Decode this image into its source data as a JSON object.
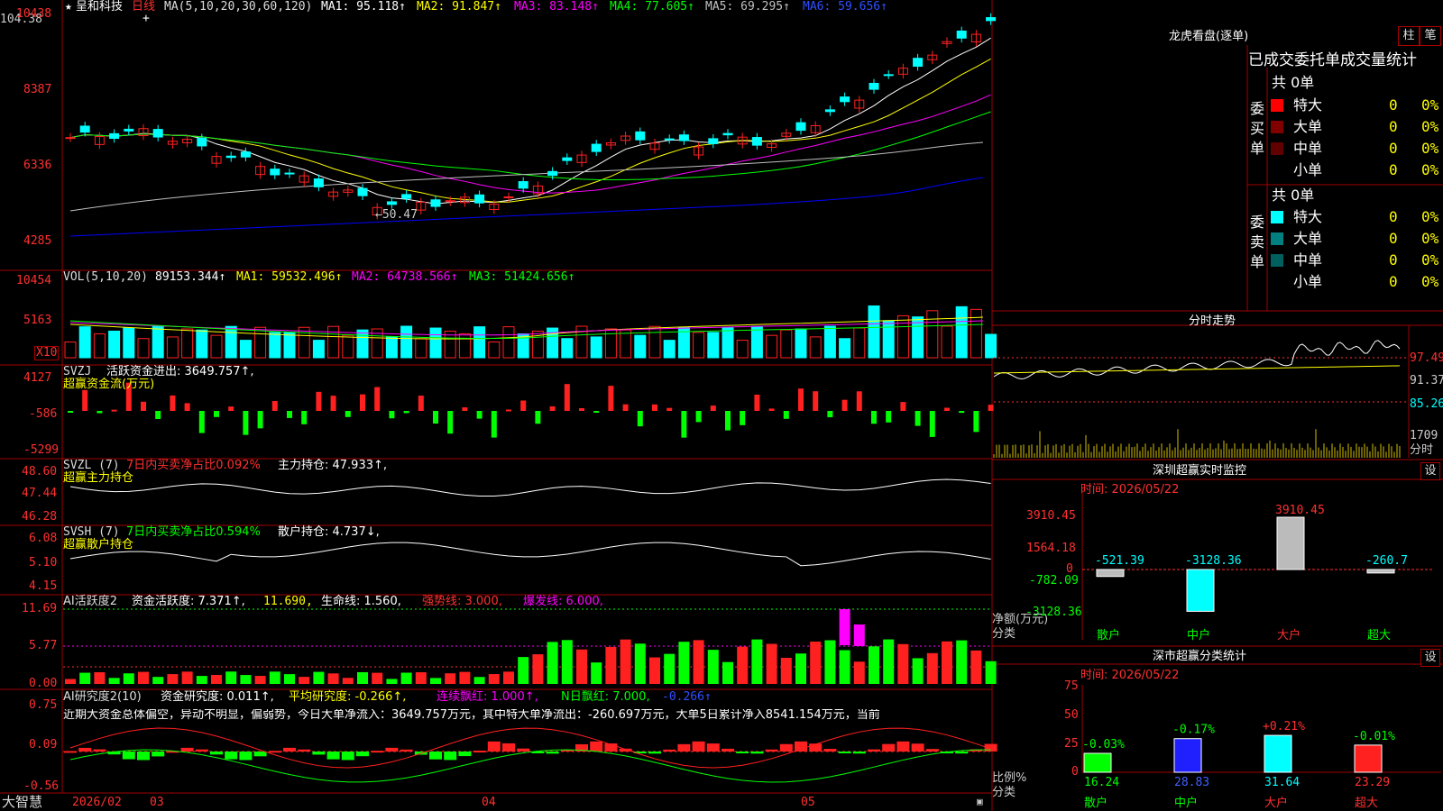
{
  "app": {
    "brand": "大智慧"
  },
  "stock": {
    "name": "呈和科技",
    "period": "日线"
  },
  "colors": {
    "up": "#ff2020",
    "down": "#00ffff",
    "bg": "#000000",
    "frame": "#a00000",
    "ma1": "#ffffff",
    "ma2": "#ffff00",
    "ma3": "#ff00ff",
    "ma4": "#00ff00",
    "ma5": "#c0c0c0",
    "ma6": "#0000ff",
    "axis_text": "#ff3030",
    "green": "#00ff00",
    "magenta": "#ff00ff",
    "yellow": "#ffff00"
  },
  "main_panel": {
    "header": {
      "ma_label": "MA(5,10,20,30,60,120)",
      "ma1": "MA1: 95.118↑",
      "ma2": "MA2: 91.847↑",
      "ma3": "MA3: 83.148↑",
      "ma4": "MA4: 77.605↑",
      "ma5": "MA5: 69.295↑",
      "ma6": "MA6: 59.656↑"
    },
    "y_ticks": [
      "10438",
      "8387",
      "6336",
      "4285"
    ],
    "high_label": "104.38",
    "low_label": "←50.47"
  },
  "vol_panel": {
    "header": {
      "label": "VOL(5,10,20)",
      "value": "89153.344↑",
      "ma1": "MA1: 59532.496↑",
      "ma2": "MA2: 64738.566↑",
      "ma3": "MA3: 51424.656↑"
    },
    "y_ticks": [
      "10454",
      "5163"
    ],
    "unit": "X10"
  },
  "svzj_panel": {
    "header": {
      "label": "SVZJ",
      "title": "活跃资金进出: 3649.757↑,",
      "subtitle": "超赢资金流(万元)"
    },
    "y_ticks": [
      "4127",
      "-586",
      "-5299"
    ]
  },
  "svzl_panel": {
    "header": {
      "label": "SVZL (7)",
      "ratio": "7日内买卖净占比0.092%",
      "hold": "主力持仓: 47.933↑,",
      "subtitle": "超赢主力持仓"
    },
    "y_ticks": [
      "48.60",
      "47.44",
      "46.28"
    ]
  },
  "svsh_panel": {
    "header": {
      "label": "SVSH (7)",
      "ratio": "7日内买卖净占比0.594%",
      "hold": "散户持仓: 4.737↓,",
      "subtitle": "超赢散户持仓"
    },
    "y_ticks": [
      "6.08",
      "5.10",
      "4.15"
    ]
  },
  "ai_active_panel": {
    "header": {
      "label": "AI活跃度2",
      "active": "资金活跃度: 7.371↑,",
      "v2": "11.690,",
      "life": "生命线: 1.560,",
      "strong": "强势线: 3.000,",
      "burst": "爆发线: 6.000,"
    },
    "y_ticks": [
      "11.69",
      "5.77",
      "0.00"
    ]
  },
  "ai_research_panel": {
    "header": {
      "label": "AI研究度2(10)",
      "research": "资金研究度: 0.011↑,",
      "avg": "平均研究度: -0.266↑,",
      "streak": "连续飘红: 1.000↑,",
      "nday": "N日飘红: 7.000,",
      "last": "-0.266↑"
    },
    "comment": "近期大资金总体偏空，异动不明显，偏弱势，今日大单净流入：3649.757万元，其中特大单净流出：-260.697万元，大单5日累计净入8541.154万元，当前",
    "y_ticks": [
      "0.75",
      "0.09",
      "-0.56"
    ]
  },
  "x_axis": {
    "labels": [
      "2026/02",
      "03",
      "04",
      "05"
    ]
  },
  "dragon_tiger": {
    "title": "龙虎看盘(逐单)",
    "btn_bar": "柱",
    "btn_stroke": "笔",
    "subtitle": "已成交委托单成交量统计",
    "buy": {
      "side": "委买单",
      "total": "共 0单",
      "rows": [
        {
          "label": "特大",
          "count": "0",
          "pct": "0%",
          "color": "#ff0000"
        },
        {
          "label": "大单",
          "count": "0",
          "pct": "0%",
          "color": "#800000"
        },
        {
          "label": "中单",
          "count": "0",
          "pct": "0%",
          "color": "#600000"
        },
        {
          "label": "小单",
          "count": "0",
          "pct": "0%",
          "color": "#000000"
        }
      ]
    },
    "sell": {
      "side": "委卖单",
      "total": "共 0单",
      "rows": [
        {
          "label": "特大",
          "count": "0",
          "pct": "0%",
          "color": "#00ffff"
        },
        {
          "label": "大单",
          "count": "0",
          "pct": "0%",
          "color": "#008080"
        },
        {
          "label": "中单",
          "count": "0",
          "pct": "0%",
          "color": "#006060"
        },
        {
          "label": "小单",
          "count": "0",
          "pct": "0%",
          "color": "#000000"
        }
      ]
    }
  },
  "intraday": {
    "title": "分时走势",
    "y_ticks": [
      "97.49",
      "91.37",
      "85.26"
    ],
    "vol_tick": "1709",
    "vol_unit": "分时"
  },
  "realtime_monitor": {
    "title": "深圳超赢实时监控",
    "btn": "设",
    "time": "时间: 2026/05/22",
    "y_ticks": [
      "3910.45",
      "1564.18",
      "0",
      "-782.09",
      "-3128.36"
    ],
    "ylabel": "净额(万元)",
    "xlabel": "分类"
  },
  "class_stats": {
    "title": "深市超赢分类统计",
    "btn": "设",
    "time": "时间: 2026/05/22",
    "y_ticks": [
      "75",
      "50",
      "25",
      "0"
    ],
    "ylabel": "比例%",
    "xlabel": "分类"
  },
  "chart_data": [
    {
      "type": "bar",
      "title": "深圳超赢实时监控",
      "categories": [
        "散户",
        "中户",
        "大户",
        "超大"
      ],
      "values": [
        -521.39,
        -3128.36,
        3910.45,
        -260.7
      ],
      "ylabel": "净额(万元)",
      "xlabel": "分类",
      "ylim": [
        -3128.36,
        3910.45
      ]
    },
    {
      "type": "bar",
      "title": "深市超赢分类统计",
      "categories": [
        "散户",
        "中户",
        "大户",
        "超大"
      ],
      "values": [
        16.24,
        28.83,
        31.64,
        23.29
      ],
      "changes": [
        "-0.03%",
        "-0.17%",
        "+0.21%",
        "-0.01%"
      ],
      "ylabel": "比例%",
      "xlabel": "分类",
      "ylim": [
        0,
        75
      ]
    }
  ]
}
